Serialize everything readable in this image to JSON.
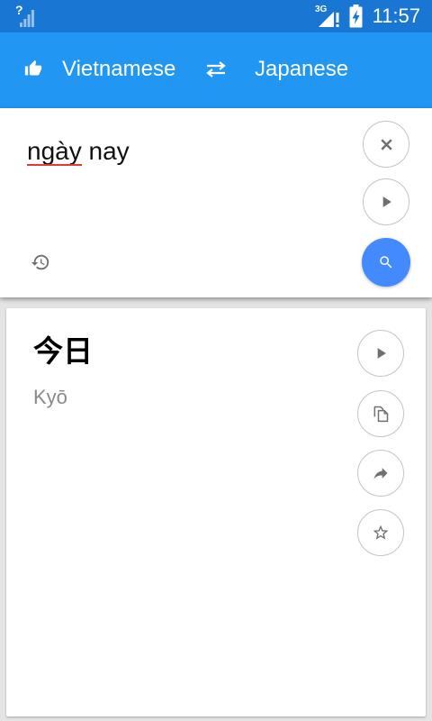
{
  "status_bar": {
    "sim_indicator": "?",
    "network_type": "3G",
    "time": "11:57",
    "icons": [
      "no-sim-signal-icon",
      "mobile-signal-alert-icon",
      "battery-charging-icon"
    ]
  },
  "app_bar": {
    "rate_icon": "thumbs-up-icon",
    "source_language": "Vietnamese",
    "swap_icon": "swap-languages-icon",
    "target_language": "Japanese"
  },
  "input": {
    "words": [
      {
        "text": "ngày",
        "spell_error": true
      },
      {
        "text": "nay",
        "spell_error": false
      }
    ],
    "buttons": [
      {
        "action": "clear",
        "icon": "close-icon"
      },
      {
        "action": "speak",
        "icon": "play-icon"
      },
      {
        "action": "history",
        "icon": "history-icon"
      },
      {
        "action": "translate",
        "icon": "search-icon"
      }
    ]
  },
  "result": {
    "translation": "今日",
    "transliteration": "Kyō",
    "buttons": [
      {
        "action": "speak",
        "icon": "play-icon"
      },
      {
        "action": "copy",
        "icon": "copy-icon"
      },
      {
        "action": "share",
        "icon": "share-icon"
      },
      {
        "action": "favorite",
        "icon": "star-outline-icon"
      }
    ]
  },
  "colors": {
    "status_bar": "#1976D2",
    "app_bar": "#2196F3",
    "accent": "#448AFF",
    "background": "#E4E4E4",
    "card": "#FFFFFF",
    "icon_gray": "#707070",
    "border_gray": "#C4C4C4",
    "spell_error": "#E53935",
    "secondary_text": "#8A8A8A"
  }
}
